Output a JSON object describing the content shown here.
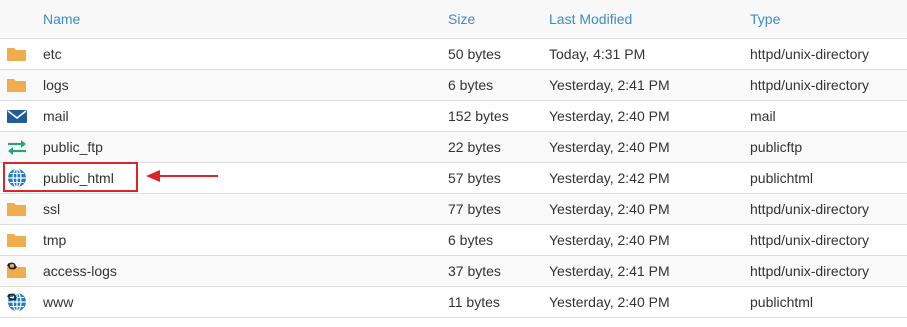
{
  "headers": {
    "name": "Name",
    "size": "Size",
    "last_modified": "Last Modified",
    "type": "Type"
  },
  "rows": [
    {
      "icon": "folder-icon",
      "name": "etc",
      "size": "50 bytes",
      "modified": "Today, 4:31 PM",
      "type": "httpd/unix-directory"
    },
    {
      "icon": "folder-icon",
      "name": "logs",
      "size": "6 bytes",
      "modified": "Yesterday, 2:41 PM",
      "type": "httpd/unix-directory"
    },
    {
      "icon": "mail-icon",
      "name": "mail",
      "size": "152 bytes",
      "modified": "Yesterday, 2:40 PM",
      "type": "mail"
    },
    {
      "icon": "transfer-arrows-icon",
      "name": "public_ftp",
      "size": "22 bytes",
      "modified": "Yesterday, 2:40 PM",
      "type": "publicftp"
    },
    {
      "icon": "globe-icon",
      "name": "public_html",
      "size": "57 bytes",
      "modified": "Yesterday, 2:42 PM",
      "type": "publichtml"
    },
    {
      "icon": "folder-icon",
      "name": "ssl",
      "size": "77 bytes",
      "modified": "Yesterday, 2:40 PM",
      "type": "httpd/unix-directory"
    },
    {
      "icon": "folder-icon",
      "name": "tmp",
      "size": "6 bytes",
      "modified": "Yesterday, 2:40 PM",
      "type": "httpd/unix-directory"
    },
    {
      "icon": "folder-link-icon",
      "name": "access-logs",
      "size": "37 bytes",
      "modified": "Yesterday, 2:41 PM",
      "type": "httpd/unix-directory"
    },
    {
      "icon": "globe-link-icon",
      "name": "www",
      "size": "11 bytes",
      "modified": "Yesterday, 2:40 PM",
      "type": "publichtml"
    }
  ],
  "colors": {
    "header_text": "#3f8bc6",
    "folder": "#f0ad4e",
    "mail": "#1f5c99",
    "transfer": "#26a579",
    "globe": "#1f7dc8",
    "annotation": "#d9262b"
  }
}
